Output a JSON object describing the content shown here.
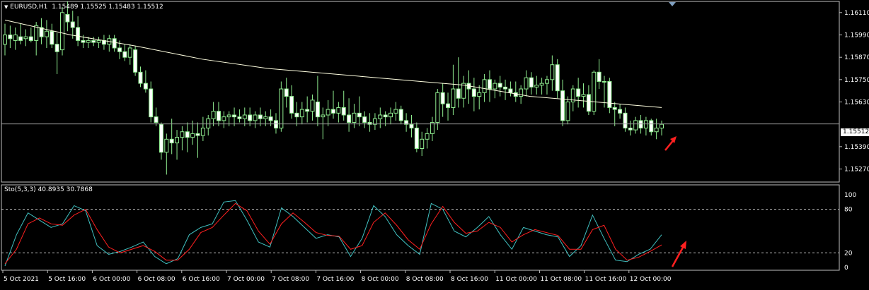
{
  "main_panel": {
    "symbol": "EURUSD,H1",
    "ohlc": "1.15489 1.15525 1.15483 1.15512",
    "current_price": "1.15512",
    "price_labels": [
      "1.16110",
      "1.15990",
      "1.15870",
      "1.15750",
      "1.15630",
      "1.15390",
      "1.15270"
    ]
  },
  "sub_panel": {
    "indicator": "Sto(5,3,3) 40.8935 30.7868",
    "level_labels": [
      "100",
      "80",
      "20",
      "0"
    ]
  },
  "time_labels": [
    "5 Oct 2021",
    "5 Oct 16:00",
    "6 Oct 00:00",
    "6 Oct 08:00",
    "6 Oct 16:00",
    "7 Oct 00:00",
    "7 Oct 08:00",
    "7 Oct 16:00",
    "8 Oct 00:00",
    "8 Oct 08:00",
    "8 Oct 16:00",
    "11 Oct 00:00",
    "11 Oct 08:00",
    "11 Oct 16:00",
    "12 Oct 00:00"
  ],
  "colors": {
    "background": "#000000",
    "grid": "#c0c0c0",
    "candle": "#90ee90",
    "ma_line": "#ffffe0",
    "stoch_main": "#40c0c0",
    "stoch_signal": "#ff2020",
    "arrow": "#ff2020"
  },
  "chart_data": [
    {
      "type": "candlestick",
      "title": "EURUSD,H1",
      "ylim": [
        1.152,
        1.1617
      ],
      "candles": [
        {
          "o": 1.1594,
          "h": 1.1605,
          "l": 1.1588,
          "c": 1.1599
        },
        {
          "o": 1.1599,
          "h": 1.1604,
          "l": 1.1592,
          "c": 1.1597
        },
        {
          "o": 1.1596,
          "h": 1.1603,
          "l": 1.1591,
          "c": 1.1599
        },
        {
          "o": 1.1598,
          "h": 1.1605,
          "l": 1.1594,
          "c": 1.1596
        },
        {
          "o": 1.1597,
          "h": 1.1602,
          "l": 1.1593,
          "c": 1.1598
        },
        {
          "o": 1.1598,
          "h": 1.1603,
          "l": 1.1595,
          "c": 1.1596
        },
        {
          "o": 1.1596,
          "h": 1.1606,
          "l": 1.1588,
          "c": 1.1604
        },
        {
          "o": 1.1603,
          "h": 1.1608,
          "l": 1.1594,
          "c": 1.1598
        },
        {
          "o": 1.1598,
          "h": 1.1607,
          "l": 1.1592,
          "c": 1.1601
        },
        {
          "o": 1.1601,
          "h": 1.1605,
          "l": 1.1592,
          "c": 1.1594
        },
        {
          "o": 1.1594,
          "h": 1.16,
          "l": 1.1578,
          "c": 1.159
        },
        {
          "o": 1.1591,
          "h": 1.1614,
          "l": 1.1588,
          "c": 1.1611
        },
        {
          "o": 1.161,
          "h": 1.1617,
          "l": 1.1601,
          "c": 1.1606
        },
        {
          "o": 1.1606,
          "h": 1.1612,
          "l": 1.1597,
          "c": 1.1603
        },
        {
          "o": 1.1603,
          "h": 1.1609,
          "l": 1.1593,
          "c": 1.1596
        },
        {
          "o": 1.1596,
          "h": 1.1599,
          "l": 1.1592,
          "c": 1.1595
        },
        {
          "o": 1.1595,
          "h": 1.1598,
          "l": 1.1592,
          "c": 1.1596
        },
        {
          "o": 1.1596,
          "h": 1.1598,
          "l": 1.1593,
          "c": 1.1595
        },
        {
          "o": 1.1595,
          "h": 1.1598,
          "l": 1.1592,
          "c": 1.1596
        },
        {
          "o": 1.1596,
          "h": 1.1599,
          "l": 1.1591,
          "c": 1.1594
        },
        {
          "o": 1.1594,
          "h": 1.1599,
          "l": 1.159,
          "c": 1.1597
        },
        {
          "o": 1.1597,
          "h": 1.1599,
          "l": 1.159,
          "c": 1.1592
        },
        {
          "o": 1.1592,
          "h": 1.1596,
          "l": 1.1586,
          "c": 1.159
        },
        {
          "o": 1.159,
          "h": 1.1594,
          "l": 1.1585,
          "c": 1.1587
        },
        {
          "o": 1.1587,
          "h": 1.1594,
          "l": 1.1583,
          "c": 1.1592
        },
        {
          "o": 1.1591,
          "h": 1.1593,
          "l": 1.1577,
          "c": 1.1579
        },
        {
          "o": 1.1579,
          "h": 1.1582,
          "l": 1.1571,
          "c": 1.1573
        },
        {
          "o": 1.1573,
          "h": 1.158,
          "l": 1.1568,
          "c": 1.157
        },
        {
          "o": 1.157,
          "h": 1.1574,
          "l": 1.1552,
          "c": 1.1555
        },
        {
          "o": 1.1555,
          "h": 1.156,
          "l": 1.155,
          "c": 1.1552
        },
        {
          "o": 1.1551,
          "h": 1.1552,
          "l": 1.1532,
          "c": 1.1536
        },
        {
          "o": 1.1536,
          "h": 1.1546,
          "l": 1.1524,
          "c": 1.1543
        },
        {
          "o": 1.1543,
          "h": 1.1554,
          "l": 1.1535,
          "c": 1.1541
        },
        {
          "o": 1.1541,
          "h": 1.1548,
          "l": 1.1532,
          "c": 1.1544
        },
        {
          "o": 1.1544,
          "h": 1.155,
          "l": 1.1537,
          "c": 1.1547
        },
        {
          "o": 1.1547,
          "h": 1.1552,
          "l": 1.1536,
          "c": 1.1544
        },
        {
          "o": 1.1544,
          "h": 1.1553,
          "l": 1.154,
          "c": 1.1546
        },
        {
          "o": 1.1546,
          "h": 1.1552,
          "l": 1.1533,
          "c": 1.1545
        },
        {
          "o": 1.1545,
          "h": 1.1555,
          "l": 1.1542,
          "c": 1.1549
        },
        {
          "o": 1.1549,
          "h": 1.1556,
          "l": 1.1545,
          "c": 1.1554
        },
        {
          "o": 1.1554,
          "h": 1.1563,
          "l": 1.155,
          "c": 1.1558
        },
        {
          "o": 1.1558,
          "h": 1.1563,
          "l": 1.155,
          "c": 1.1553
        },
        {
          "o": 1.1553,
          "h": 1.1558,
          "l": 1.1549,
          "c": 1.1555
        },
        {
          "o": 1.1555,
          "h": 1.1558,
          "l": 1.155,
          "c": 1.1556
        },
        {
          "o": 1.1556,
          "h": 1.156,
          "l": 1.155,
          "c": 1.1555
        },
        {
          "o": 1.1555,
          "h": 1.1559,
          "l": 1.1552,
          "c": 1.1554
        },
        {
          "o": 1.1554,
          "h": 1.156,
          "l": 1.155,
          "c": 1.1556
        },
        {
          "o": 1.1556,
          "h": 1.156,
          "l": 1.155,
          "c": 1.1553
        },
        {
          "o": 1.1553,
          "h": 1.1558,
          "l": 1.1549,
          "c": 1.1556
        },
        {
          "o": 1.1556,
          "h": 1.156,
          "l": 1.155,
          "c": 1.1554
        },
        {
          "o": 1.1554,
          "h": 1.1558,
          "l": 1.155,
          "c": 1.1555
        },
        {
          "o": 1.1555,
          "h": 1.1559,
          "l": 1.155,
          "c": 1.1553
        },
        {
          "o": 1.1553,
          "h": 1.1557,
          "l": 1.1546,
          "c": 1.1549
        },
        {
          "o": 1.1549,
          "h": 1.1574,
          "l": 1.1547,
          "c": 1.157
        },
        {
          "o": 1.157,
          "h": 1.1576,
          "l": 1.156,
          "c": 1.1566
        },
        {
          "o": 1.1566,
          "h": 1.1572,
          "l": 1.1554,
          "c": 1.1557
        },
        {
          "o": 1.1557,
          "h": 1.1563,
          "l": 1.155,
          "c": 1.1555
        },
        {
          "o": 1.1555,
          "h": 1.1563,
          "l": 1.1551,
          "c": 1.1559
        },
        {
          "o": 1.1559,
          "h": 1.1566,
          "l": 1.1552,
          "c": 1.1558
        },
        {
          "o": 1.1558,
          "h": 1.1567,
          "l": 1.1553,
          "c": 1.1564
        },
        {
          "o": 1.1563,
          "h": 1.1577,
          "l": 1.155,
          "c": 1.1555
        },
        {
          "o": 1.1555,
          "h": 1.156,
          "l": 1.1543,
          "c": 1.1556
        },
        {
          "o": 1.1556,
          "h": 1.1564,
          "l": 1.155,
          "c": 1.1559
        },
        {
          "o": 1.1559,
          "h": 1.1569,
          "l": 1.1554,
          "c": 1.1557
        },
        {
          "o": 1.1557,
          "h": 1.1563,
          "l": 1.1552,
          "c": 1.156
        },
        {
          "o": 1.156,
          "h": 1.1569,
          "l": 1.1553,
          "c": 1.1556
        },
        {
          "o": 1.1556,
          "h": 1.1565,
          "l": 1.1547,
          "c": 1.1552
        },
        {
          "o": 1.1552,
          "h": 1.1562,
          "l": 1.1549,
          "c": 1.1557
        },
        {
          "o": 1.1557,
          "h": 1.1566,
          "l": 1.155,
          "c": 1.1555
        },
        {
          "o": 1.1555,
          "h": 1.1558,
          "l": 1.1549,
          "c": 1.1552
        },
        {
          "o": 1.1552,
          "h": 1.1557,
          "l": 1.1547,
          "c": 1.1551
        },
        {
          "o": 1.1551,
          "h": 1.1557,
          "l": 1.1548,
          "c": 1.1554
        },
        {
          "o": 1.1554,
          "h": 1.156,
          "l": 1.1549,
          "c": 1.1556
        },
        {
          "o": 1.1556,
          "h": 1.1558,
          "l": 1.155,
          "c": 1.1555
        },
        {
          "o": 1.1555,
          "h": 1.156,
          "l": 1.1551,
          "c": 1.1557
        },
        {
          "o": 1.1557,
          "h": 1.1563,
          "l": 1.1553,
          "c": 1.1559
        },
        {
          "o": 1.1559,
          "h": 1.1561,
          "l": 1.1551,
          "c": 1.1553
        },
        {
          "o": 1.1553,
          "h": 1.1557,
          "l": 1.1547,
          "c": 1.1551
        },
        {
          "o": 1.1551,
          "h": 1.1556,
          "l": 1.1544,
          "c": 1.1549
        },
        {
          "o": 1.1549,
          "h": 1.1552,
          "l": 1.1536,
          "c": 1.1538
        },
        {
          "o": 1.1538,
          "h": 1.1547,
          "l": 1.1534,
          "c": 1.1543
        },
        {
          "o": 1.1543,
          "h": 1.1549,
          "l": 1.1538,
          "c": 1.1546
        },
        {
          "o": 1.1546,
          "h": 1.1555,
          "l": 1.1542,
          "c": 1.1552
        },
        {
          "o": 1.1552,
          "h": 1.157,
          "l": 1.1548,
          "c": 1.1568
        },
        {
          "o": 1.1568,
          "h": 1.1573,
          "l": 1.1555,
          "c": 1.1562
        },
        {
          "o": 1.1562,
          "h": 1.1568,
          "l": 1.1553,
          "c": 1.156
        },
        {
          "o": 1.156,
          "h": 1.1583,
          "l": 1.1556,
          "c": 1.157
        },
        {
          "o": 1.157,
          "h": 1.1587,
          "l": 1.156,
          "c": 1.1565
        },
        {
          "o": 1.1565,
          "h": 1.1577,
          "l": 1.156,
          "c": 1.1573
        },
        {
          "o": 1.1573,
          "h": 1.158,
          "l": 1.1562,
          "c": 1.157
        },
        {
          "o": 1.157,
          "h": 1.1576,
          "l": 1.1558,
          "c": 1.1566
        },
        {
          "o": 1.1566,
          "h": 1.1572,
          "l": 1.1559,
          "c": 1.1568
        },
        {
          "o": 1.1568,
          "h": 1.1578,
          "l": 1.1563,
          "c": 1.1575
        },
        {
          "o": 1.1575,
          "h": 1.158,
          "l": 1.1563,
          "c": 1.157
        },
        {
          "o": 1.157,
          "h": 1.1575,
          "l": 1.1565,
          "c": 1.1573
        },
        {
          "o": 1.1573,
          "h": 1.1577,
          "l": 1.1566,
          "c": 1.1571
        },
        {
          "o": 1.1571,
          "h": 1.1575,
          "l": 1.1564,
          "c": 1.157
        },
        {
          "o": 1.157,
          "h": 1.1574,
          "l": 1.1566,
          "c": 1.1568
        },
        {
          "o": 1.1568,
          "h": 1.1574,
          "l": 1.1563,
          "c": 1.1566
        },
        {
          "o": 1.1566,
          "h": 1.1572,
          "l": 1.1562,
          "c": 1.157
        },
        {
          "o": 1.157,
          "h": 1.158,
          "l": 1.1566,
          "c": 1.1576
        },
        {
          "o": 1.1576,
          "h": 1.1579,
          "l": 1.1567,
          "c": 1.1571
        },
        {
          "o": 1.1571,
          "h": 1.1577,
          "l": 1.1567,
          "c": 1.1572
        },
        {
          "o": 1.1572,
          "h": 1.1576,
          "l": 1.1567,
          "c": 1.1573
        },
        {
          "o": 1.1573,
          "h": 1.1577,
          "l": 1.1567,
          "c": 1.1575
        },
        {
          "o": 1.1575,
          "h": 1.1588,
          "l": 1.1569,
          "c": 1.1583
        },
        {
          "o": 1.1583,
          "h": 1.1586,
          "l": 1.1565,
          "c": 1.1569
        },
        {
          "o": 1.1569,
          "h": 1.1575,
          "l": 1.155,
          "c": 1.1553
        },
        {
          "o": 1.1553,
          "h": 1.1566,
          "l": 1.1551,
          "c": 1.1563
        },
        {
          "o": 1.1563,
          "h": 1.1572,
          "l": 1.1558,
          "c": 1.157
        },
        {
          "o": 1.157,
          "h": 1.1576,
          "l": 1.156,
          "c": 1.1566
        },
        {
          "o": 1.1566,
          "h": 1.1573,
          "l": 1.156,
          "c": 1.1567
        },
        {
          "o": 1.1567,
          "h": 1.1572,
          "l": 1.1556,
          "c": 1.1558
        },
        {
          "o": 1.1558,
          "h": 1.158,
          "l": 1.1556,
          "c": 1.1579
        },
        {
          "o": 1.1579,
          "h": 1.1586,
          "l": 1.157,
          "c": 1.1574
        },
        {
          "o": 1.1574,
          "h": 1.1577,
          "l": 1.156,
          "c": 1.1574
        },
        {
          "o": 1.1574,
          "h": 1.1576,
          "l": 1.1557,
          "c": 1.156
        },
        {
          "o": 1.156,
          "h": 1.1563,
          "l": 1.155,
          "c": 1.1559
        },
        {
          "o": 1.1559,
          "h": 1.1562,
          "l": 1.1554,
          "c": 1.1557
        },
        {
          "o": 1.1557,
          "h": 1.156,
          "l": 1.1547,
          "c": 1.1549
        },
        {
          "o": 1.1549,
          "h": 1.1553,
          "l": 1.1545,
          "c": 1.1548
        },
        {
          "o": 1.1548,
          "h": 1.1555,
          "l": 1.1546,
          "c": 1.1553
        },
        {
          "o": 1.1553,
          "h": 1.1556,
          "l": 1.1546,
          "c": 1.1549
        },
        {
          "o": 1.1549,
          "h": 1.1555,
          "l": 1.1545,
          "c": 1.1553
        },
        {
          "o": 1.1553,
          "h": 1.1554,
          "l": 1.1545,
          "c": 1.1547
        },
        {
          "o": 1.1547,
          "h": 1.1554,
          "l": 1.1543,
          "c": 1.1549
        },
        {
          "o": 1.1549,
          "h": 1.1553,
          "l": 1.1545,
          "c": 1.1551
        }
      ],
      "moving_average": [
        1.1607,
        1.1599,
        1.1593,
        1.1586,
        1.1581,
        1.1578,
        1.1575,
        1.1572,
        1.1566,
        1.1563,
        1.156
      ]
    },
    {
      "type": "line",
      "title": "Sto(5,3,3) 40.8935 30.7868",
      "ylim": [
        0,
        100
      ],
      "levels": [
        80,
        20
      ],
      "series": [
        {
          "values": [
            2,
            45,
            75,
            65,
            55,
            60,
            85,
            78,
            30,
            18,
            22,
            28,
            35,
            15,
            5,
            12,
            45,
            55,
            60,
            90,
            92,
            65,
            35,
            28,
            82,
            70,
            55,
            40,
            45,
            42,
            15,
            40,
            85,
            70,
            45,
            30,
            18,
            88,
            80,
            50,
            42,
            55,
            70,
            45,
            25,
            55,
            50,
            45,
            42,
            15,
            30,
            72,
            40,
            10,
            8,
            18,
            25,
            45
          ]
        },
        {
          "values": [
            5,
            25,
            60,
            68,
            60,
            58,
            72,
            80,
            52,
            28,
            20,
            25,
            30,
            22,
            10,
            10,
            25,
            48,
            55,
            72,
            88,
            78,
            50,
            32,
            60,
            75,
            62,
            48,
            44,
            43,
            25,
            30,
            62,
            75,
            58,
            38,
            25,
            60,
            84,
            62,
            47,
            50,
            62,
            55,
            35,
            45,
            52,
            48,
            44,
            25,
            25,
            52,
            58,
            25,
            10,
            14,
            22,
            31
          ]
        }
      ]
    }
  ]
}
